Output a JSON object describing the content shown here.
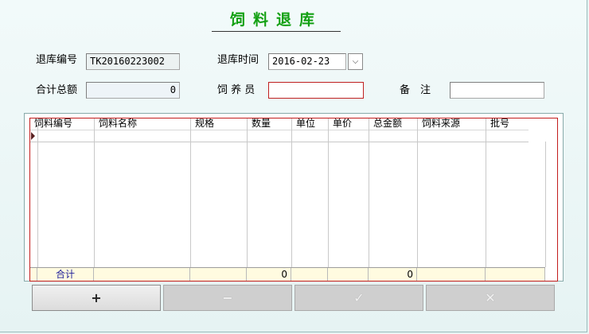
{
  "window": {
    "title": "饲料退库"
  },
  "form": {
    "return_no_label": "退库编号",
    "return_no_value": "TK20160223002",
    "return_time_label": "退库时间",
    "return_time_value": "2016-02-23",
    "total_amount_label": "合计总额",
    "total_amount_value": "0",
    "keeper_label": "饲 养 员",
    "keeper_value": "",
    "remark_label": "备　注",
    "remark_value": ""
  },
  "grid": {
    "columns": [
      "饲料编号",
      "饲料名称",
      "规格",
      "数量",
      "单位",
      "单价",
      "总金额",
      "饲料来源",
      "批号"
    ],
    "rows": [],
    "totals": {
      "label": "合计",
      "quantity": "0",
      "amount": "0"
    }
  },
  "toolbar": {
    "add_label": "+",
    "remove_label": "−",
    "confirm_label": "✓",
    "cancel_label": "✕"
  },
  "icons": {
    "dropdown": "chevron-down-icon",
    "current_row": "row-pointer-icon"
  },
  "colors": {
    "title_green": "#12a012",
    "required_border": "#c02020",
    "grid_border": "#c21d1d",
    "total_label_blue": "#1f1f9a",
    "total_row_bg": "#fffbe0"
  }
}
